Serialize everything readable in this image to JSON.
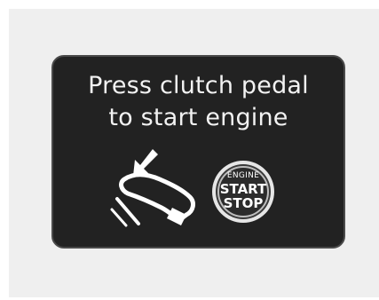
{
  "message": {
    "line1": "Press clutch pedal",
    "line2": "to start engine"
  },
  "icons": {
    "pedal": "foot-on-clutch-pedal-icon",
    "button": "engine-start-stop-button-icon"
  },
  "engine_button": {
    "top_label": "ENGINE",
    "start_label": "START",
    "stop_label": "STOP"
  },
  "colors": {
    "panel_background": "#222222",
    "text": "#f2f2f2",
    "outer_background": "#efefef"
  }
}
